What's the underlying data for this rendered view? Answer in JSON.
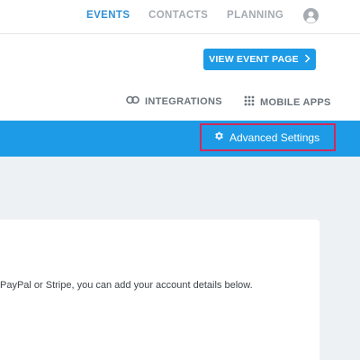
{
  "nav": {
    "events": "EVENTS",
    "contacts": "CONTACTS",
    "planning": "PLANNING",
    "user_icon": "user-circle-icon"
  },
  "header": {
    "view_event_button": "VIEW EVENT PAGE",
    "integrations_label": "INTEGRATIONS",
    "mobile_apps_label": "MOBILE APPS",
    "integrations_icon": "link-icon",
    "mobile_apps_icon": "grid-dots-icon"
  },
  "toolbar": {
    "advanced_settings_label": "Advanced Settings",
    "advanced_settings_icon": "gear-icon"
  },
  "content": {
    "payment_text": "PayPal or Stripe, you can add your account details below."
  },
  "colors": {
    "accent": "#1d9be6",
    "active_nav": "#2f8fd6",
    "highlight_border": "#d2295c"
  }
}
